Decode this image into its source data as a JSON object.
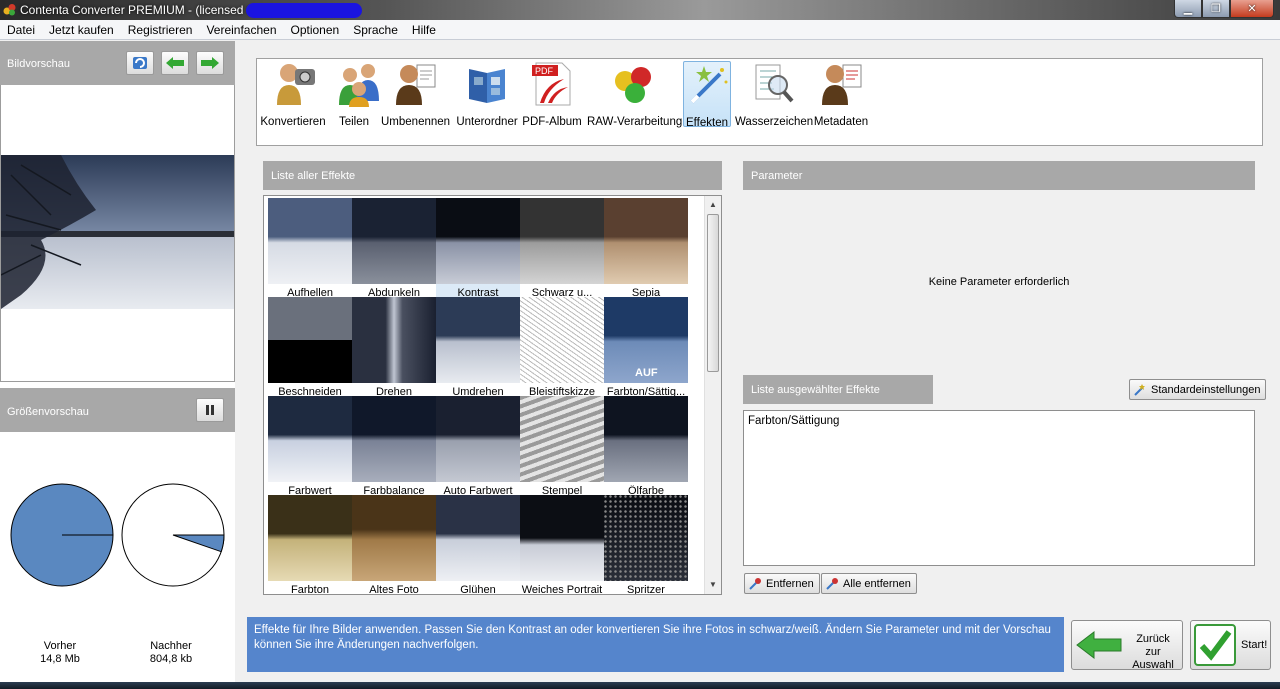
{
  "window": {
    "title": "Contenta Converter PREMIUM  - (licensed to",
    "controls": {
      "minimize": "▁",
      "maximize": "❐",
      "close": "✕"
    }
  },
  "menu": [
    "Datei",
    "Jetzt kaufen",
    "Registrieren",
    "Vereinfachen",
    "Optionen",
    "Sprache",
    "Hilfe"
  ],
  "left": {
    "preview_title": "Bildvorschau",
    "size_title": "Größenvorschau",
    "before_label": "Vorher",
    "before_size": "14,8 Mb",
    "after_label": "Nachher",
    "after_size": "804,8 kb",
    "after_fraction": 0.053
  },
  "toolbar": [
    {
      "label": "Konvertieren",
      "icon": "camera-person-icon"
    },
    {
      "label": "Teilen",
      "icon": "people-icon"
    },
    {
      "label": "Umbenennen",
      "icon": "person-document-icon"
    },
    {
      "label": "Unterordner",
      "icon": "folder-book-icon"
    },
    {
      "label": "PDF-Album",
      "icon": "pdf-icon"
    },
    {
      "label": "RAW-Verarbeitung",
      "icon": "color-balls-icon"
    },
    {
      "label": "Effekten",
      "icon": "magic-wand-icon",
      "active": true
    },
    {
      "label": "Wasserzeichen",
      "icon": "magnifier-list-icon"
    },
    {
      "label": "Metadaten",
      "icon": "person-document-icon"
    }
  ],
  "effects": {
    "title": "Liste aller Effekte",
    "items": [
      "Aufhellen",
      "Abdunkeln",
      "Kontrast",
      "Schwarz u...",
      "Sepia",
      "Beschneiden",
      "Drehen",
      "Umdrehen",
      "Bleistiftskizze",
      "Farbton/Sättig...",
      "Farbwert",
      "Farbbalance",
      "Auto Farbwert",
      "Stempel",
      "Ölfarbe",
      "Farbton",
      "Altes Foto",
      "Glühen",
      "Weiches Portrait",
      "Spritzer"
    ],
    "badge": "AUF"
  },
  "parameter": {
    "title": "Parameter",
    "message": "Keine Parameter erforderlich"
  },
  "selected": {
    "title": "Liste ausgewählter Effekte",
    "defaults_button": "Standardeinstellungen",
    "items": [
      "Farbton/Sättigung"
    ],
    "remove_button": "Entfernen",
    "remove_all_button": "Alle entfernen"
  },
  "info": "Effekte für Ihre Bilder anwenden. Passen Sie den Kontrast an oder konvertieren Sie ihre Fotos in schwarz/weiß. Ändern Sie Parameter und mit der Vorschau können Sie ihre Änderungen nachverfolgen.",
  "nav": {
    "back_line1": "Zurück",
    "back_line2": "zur Auswahl",
    "start": "Start!"
  }
}
